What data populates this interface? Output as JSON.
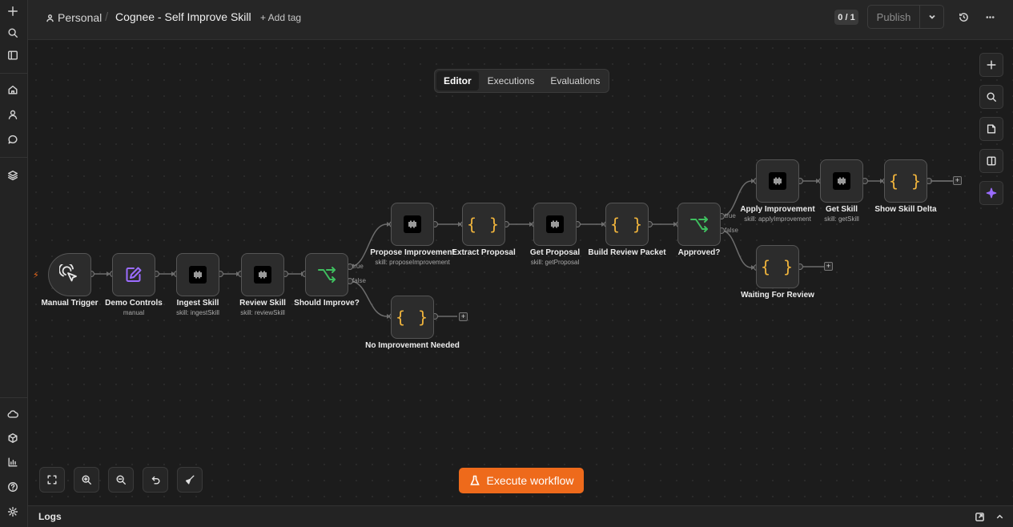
{
  "header": {
    "project": "Personal",
    "workflow_title": "Cognee - Self Improve Skill",
    "add_tag": "+ Add tag",
    "counter": "0 / 1",
    "publish": "Publish"
  },
  "tabs": [
    "Editor",
    "Executions",
    "Evaluations"
  ],
  "active_tab": "Editor",
  "execute_label": "Execute workflow",
  "logs_label": "Logs",
  "nodes": {
    "manual_trigger": {
      "label": "Manual Trigger"
    },
    "demo_controls": {
      "label": "Demo Controls",
      "sub": "manual"
    },
    "ingest_skill": {
      "label": "Ingest Skill",
      "sub": "skill: ingestSkill"
    },
    "review_skill": {
      "label": "Review Skill",
      "sub": "skill: reviewSkill"
    },
    "should_improve": {
      "label": "Should Improve?"
    },
    "propose_improvement": {
      "label": "Propose Improvement",
      "sub": "skill: proposeImprovement"
    },
    "extract_proposal": {
      "label": "Extract Proposal"
    },
    "get_proposal": {
      "label": "Get Proposal",
      "sub": "skill: getProposal"
    },
    "build_review_packet": {
      "label": "Build Review Packet"
    },
    "approved": {
      "label": "Approved?"
    },
    "apply_improvement": {
      "label": "Apply Improvement",
      "sub": "skill: applyImprovement"
    },
    "get_skill": {
      "label": "Get Skill",
      "sub": "skill: getSkill"
    },
    "show_skill_delta": {
      "label": "Show Skill Delta"
    },
    "waiting_for_review": {
      "label": "Waiting For Review"
    },
    "no_improvement_needed": {
      "label": "No Improvement Needed"
    }
  },
  "edge_labels": {
    "true": "true",
    "false": "false"
  },
  "plus_label": "+",
  "code_glyph": "{ }",
  "icons": {
    "accent": "#ee6a1b",
    "if_color": "#3fbf5f",
    "code_color": "#f0b43c",
    "ai_color": "#9b6cff"
  }
}
